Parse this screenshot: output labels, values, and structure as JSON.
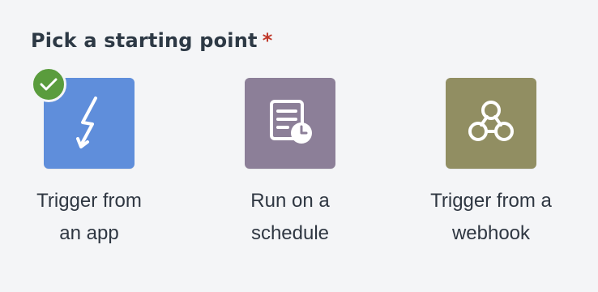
{
  "form": {
    "title": "Pick a starting point",
    "required_marker": "*"
  },
  "options": [
    {
      "label_line1": "Trigger from",
      "label_line2": "an app",
      "icon": "lightning-icon",
      "selected": true,
      "color": "#5f8edb"
    },
    {
      "label_line1": "Run on a",
      "label_line2": "schedule",
      "icon": "schedule-icon",
      "selected": false,
      "color": "#8c7f98"
    },
    {
      "label_line1": "Trigger from a",
      "label_line2": "webhook",
      "icon": "webhook-icon",
      "selected": false,
      "color": "#918e62"
    }
  ],
  "colors": {
    "background": "#f4f5f7",
    "selected_check": "#5a9c3d",
    "required": "#c0392b"
  }
}
